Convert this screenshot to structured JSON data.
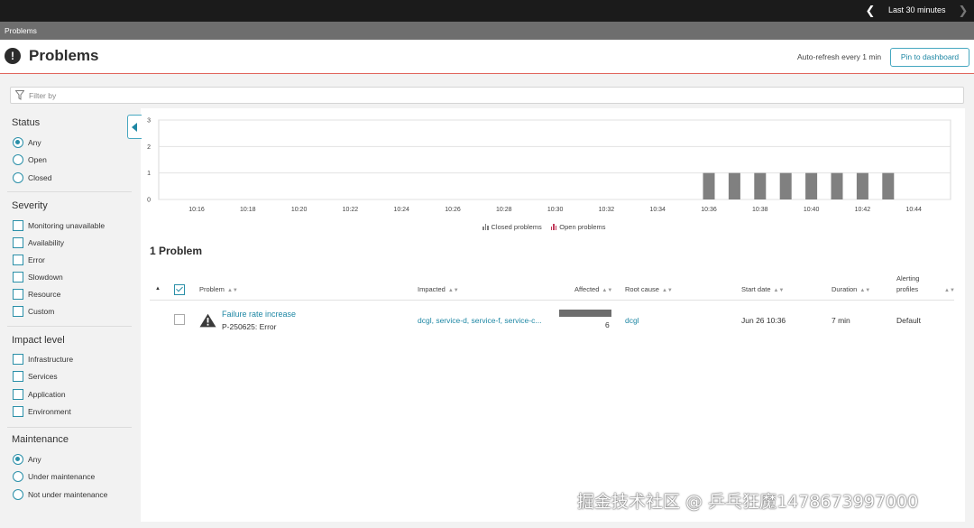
{
  "topbar": {
    "timeframe": "Last 30 minutes"
  },
  "breadcrumb": "Problems",
  "header": {
    "title": "Problems",
    "autorefresh": "Auto-refresh every 1 min",
    "pin_button": "Pin to dashboard"
  },
  "filter": {
    "placeholder": "Filter by"
  },
  "sidebar": {
    "status": {
      "title": "Status",
      "options": [
        "Any",
        "Open",
        "Closed"
      ],
      "selected": "Any"
    },
    "severity": {
      "title": "Severity",
      "options": [
        "Monitoring unavailable",
        "Availability",
        "Error",
        "Slowdown",
        "Resource",
        "Custom"
      ]
    },
    "impact": {
      "title": "Impact level",
      "options": [
        "Infrastructure",
        "Services",
        "Application",
        "Environment"
      ]
    },
    "maintenance": {
      "title": "Maintenance",
      "options": [
        "Any",
        "Under maintenance",
        "Not under maintenance"
      ],
      "selected": "Any"
    }
  },
  "chart_data": {
    "type": "bar",
    "x_ticks": [
      "10:16",
      "10:18",
      "10:20",
      "10:22",
      "10:24",
      "10:26",
      "10:28",
      "10:30",
      "10:32",
      "10:34",
      "10:36",
      "10:38",
      "10:40",
      "10:42",
      "10:44"
    ],
    "y_ticks": [
      0,
      1,
      2,
      3
    ],
    "ylim": [
      0,
      3
    ],
    "series": [
      {
        "name": "Closed problems",
        "color": "#808080",
        "points": [
          [
            "10:36",
            1
          ],
          [
            "10:37",
            1
          ],
          [
            "10:38",
            1
          ],
          [
            "10:39",
            1
          ],
          [
            "10:40",
            1
          ],
          [
            "10:41",
            1
          ],
          [
            "10:42",
            1
          ],
          [
            "10:43",
            1
          ]
        ]
      },
      {
        "name": "Open problems",
        "color": "#c0395a",
        "points": []
      }
    ],
    "grid": true,
    "legend": "bottom-center"
  },
  "problem_count": "1 Problem",
  "table": {
    "columns": {
      "problem": "Problem",
      "impacted": "Impacted",
      "affected": "Affected",
      "root_cause": "Root cause",
      "start_date": "Start date",
      "duration": "Duration",
      "alerting_1": "Alerting",
      "alerting_2": "profiles"
    },
    "rows": [
      {
        "title": "Failure rate increase",
        "id": "P-250625: Error",
        "impacted": "dcgl, service-d, service-f, service-c...",
        "affected": "6",
        "affected_fraction": 1.0,
        "root_cause": "dcgl",
        "start_date": "Jun 26 10:36",
        "duration": "7 min",
        "alerting_profile": "Default"
      }
    ]
  },
  "watermark": "掘金技术社区 @ 乒乓狂魔1478673997000"
}
